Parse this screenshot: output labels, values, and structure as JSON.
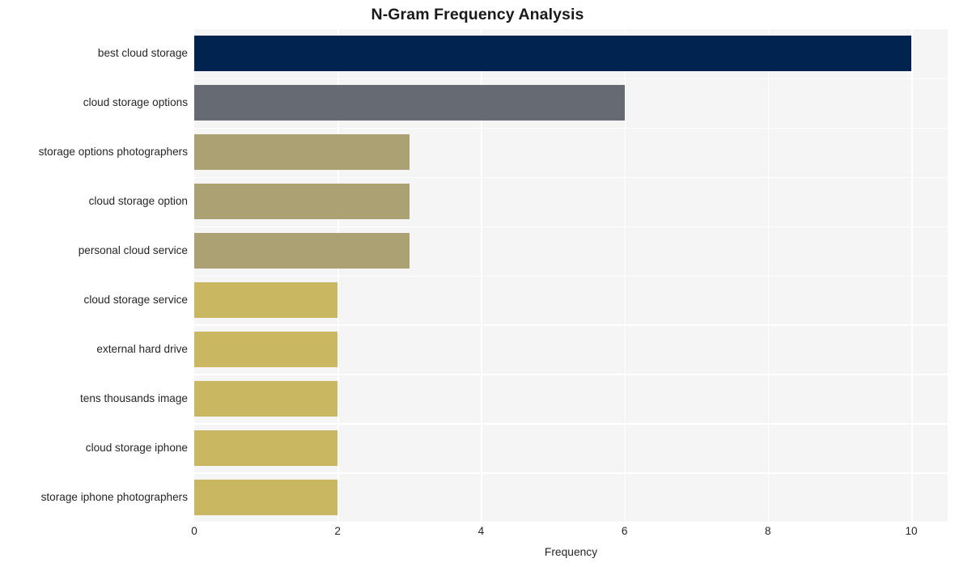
{
  "chart_data": {
    "type": "bar",
    "orientation": "horizontal",
    "title": "N-Gram Frequency Analysis",
    "xlabel": "Frequency",
    "ylabel": "",
    "categories": [
      "best cloud storage",
      "cloud storage options",
      "storage options photographers",
      "cloud storage option",
      "personal cloud service",
      "cloud storage service",
      "external hard drive",
      "tens thousands image",
      "cloud storage iphone",
      "storage iphone photographers"
    ],
    "values": [
      10,
      6,
      3,
      3,
      3,
      2,
      2,
      2,
      2,
      2
    ],
    "bar_colors": [
      "#00244f",
      "#666a73",
      "#aba172",
      "#aba172",
      "#aba172",
      "#c9b761",
      "#c9b761",
      "#c9b761",
      "#c9b761",
      "#c9b761"
    ],
    "xlim": [
      0,
      10.5
    ],
    "xticks": [
      0,
      2,
      4,
      6,
      8,
      10
    ],
    "xtick_labels": [
      "0",
      "2",
      "4",
      "6",
      "8",
      "10"
    ],
    "grid": true,
    "grid_color": "#ffffff",
    "plot_background": "#f5f5f6",
    "figure_background": "#ffffff",
    "legend": "none"
  }
}
